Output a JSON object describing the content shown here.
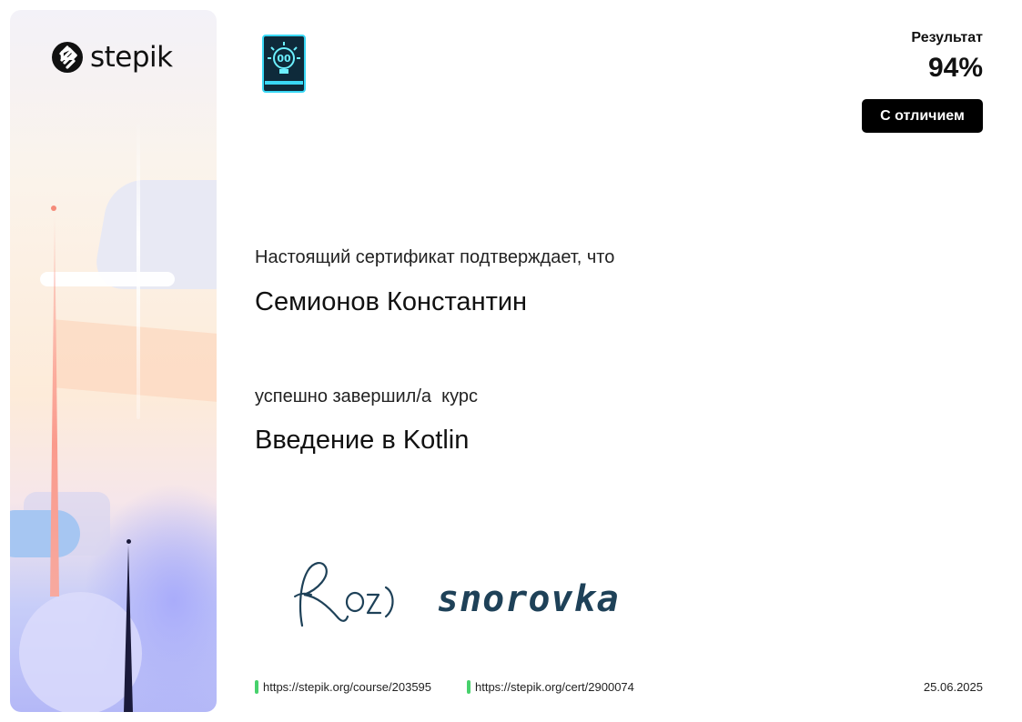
{
  "brand": {
    "logo_text": "stepik",
    "logo_icon": "stepik-s-icon"
  },
  "course_badge_icon": "book-lightbulb-icon",
  "result": {
    "label": "Результат",
    "value": "94%",
    "distinction": "С отличием"
  },
  "certificate": {
    "confirm_text": "Настоящий сертификат подтверждает, что",
    "recipient": "Семионов Константин",
    "completed_text": "успешно завершил/а  курс",
    "course_title": "Введение в Kotlin"
  },
  "signatures": {
    "first": "Roz",
    "second": "snorovka"
  },
  "footer": {
    "course_url": "https://stepik.org/course/203595",
    "cert_url": "https://stepik.org/cert/2900074",
    "date": "25.06.2025"
  },
  "colors": {
    "accent_green": "#47d16c",
    "badge_bg": "#000000",
    "signature_ink": "#1e4158"
  }
}
